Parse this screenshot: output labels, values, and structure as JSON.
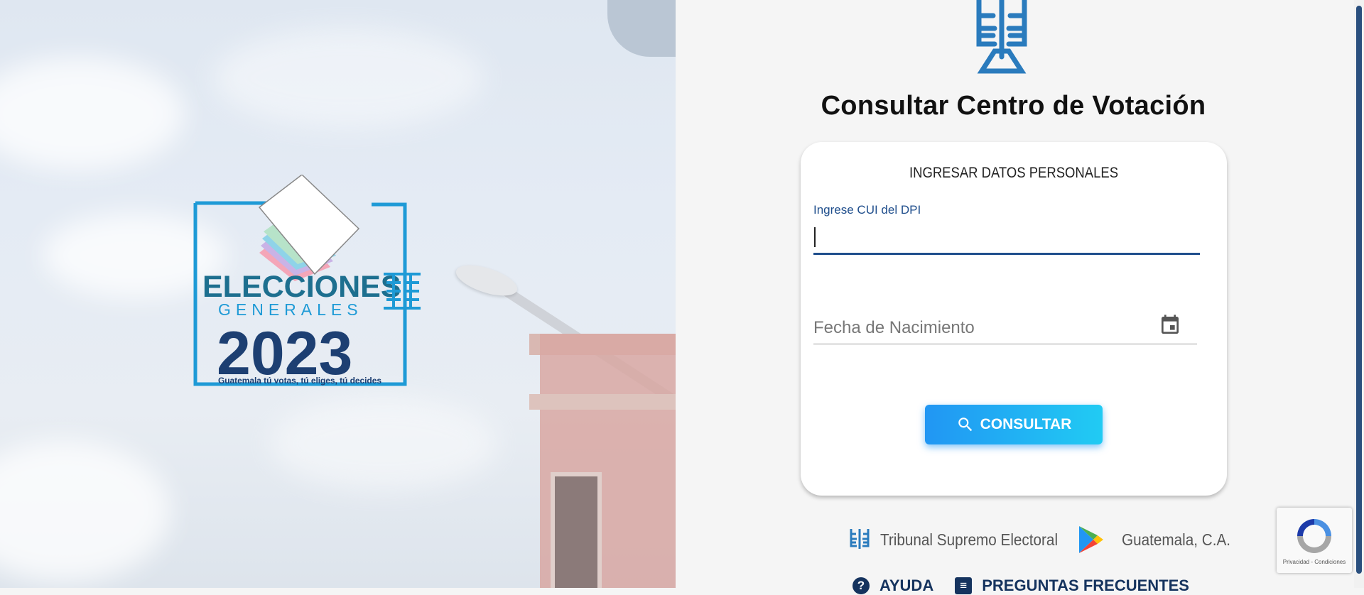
{
  "hero": {
    "logo": {
      "line1": "ELECCIONES",
      "line2": "GENERALES",
      "year": "2023",
      "tagline": "Guatemala tú votas, tú eliges, tú decides"
    }
  },
  "page": {
    "title": "Consultar Centro de Votación"
  },
  "form": {
    "section_title": "INGRESAR DATOS PERSONALES",
    "cui_label": "Ingrese CUI del DPI",
    "cui_value": "",
    "birthdate_placeholder": "Fecha de Nacimiento",
    "submit_label": "CONSULTAR"
  },
  "footer": {
    "org": "Tribunal Supremo Electoral",
    "location": "Guatemala, C.A."
  },
  "bottom_links": {
    "help": "AYUDA",
    "faq": "PREGUNTAS FRECUENTES"
  },
  "recaptcha": {
    "terms": "Privacidad - Condiciones"
  },
  "colors": {
    "accent_blue": "#1f4e8c",
    "button_start": "#2196f3",
    "button_end": "#21cbf3",
    "logo_cyan": "#1e9ad6",
    "logo_navy": "#1d3f72"
  },
  "icons": {
    "search": "search-icon",
    "calendar": "calendar-icon",
    "help": "help-circle-icon",
    "faq": "list-icon"
  }
}
